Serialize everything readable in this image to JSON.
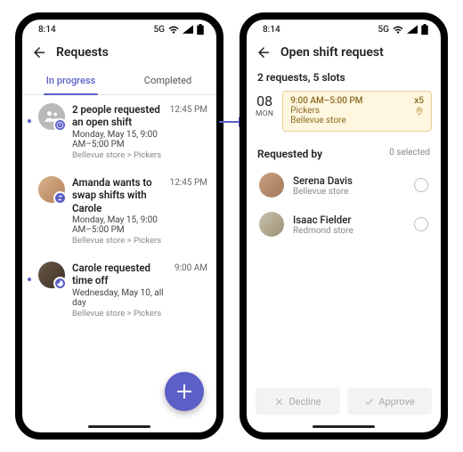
{
  "statusbar": {
    "time": "8:14",
    "network": "5G"
  },
  "left": {
    "title": "Requests",
    "tabs": {
      "in_progress": "In progress",
      "completed": "Completed"
    },
    "items": [
      {
        "title": "2 people requested an open shift",
        "sub": "Monday, May 15, 9:00 AM–5:00 PM",
        "meta": "Bellevue store > Pickers",
        "time": "12:45 PM"
      },
      {
        "title": "Amanda wants to swap shifts with Carole",
        "sub": "Monday, May 15, 9:00 AM–5:00 PM",
        "meta": "Bellevue store > Pickers",
        "time": "12:45 PM"
      },
      {
        "title": "Carole requested time off",
        "sub": "Wednesday, May 10, all day",
        "meta": "Bellevue store > Pickers",
        "time": "9:00 AM"
      }
    ]
  },
  "right": {
    "title": "Open shift request",
    "summary": "2 requests, 5 slots",
    "slot": {
      "day_num": "08",
      "day_abbr": "MON",
      "time": "9:00 AM–5:00 PM",
      "count": "x5",
      "group": "Pickers",
      "store": "Bellevue store"
    },
    "requested_by_label": "Requested by",
    "selected_count": "0 selected",
    "people": [
      {
        "name": "Serena Davis",
        "store": "Bellevue store"
      },
      {
        "name": "Isaac Fielder",
        "store": "Redmond store"
      }
    ],
    "actions": {
      "decline": "Decline",
      "approve": "Approve"
    }
  }
}
